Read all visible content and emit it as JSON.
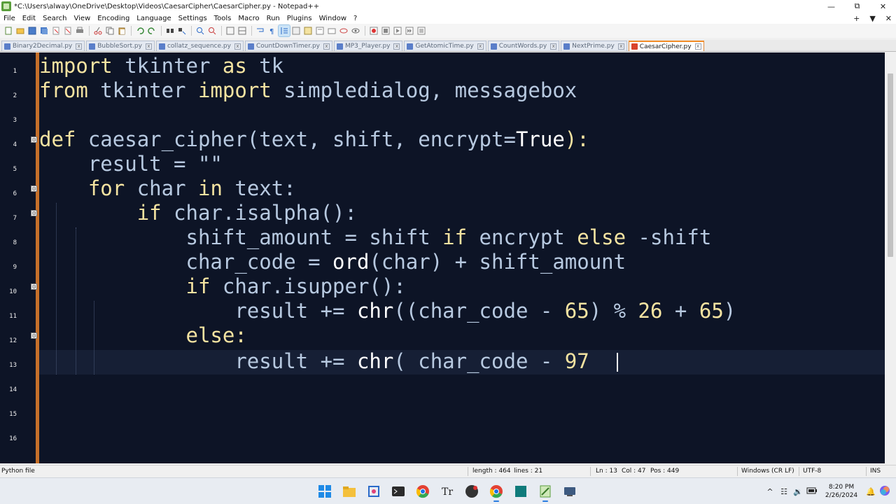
{
  "window": {
    "title": "*C:\\Users\\alway\\OneDrive\\Desktop\\Videos\\CaesarCipher\\CaesarCipher.py - Notepad++",
    "controls": {
      "minimize": "—",
      "restore": "⧉",
      "close": "✕"
    }
  },
  "menu": {
    "items": [
      "File",
      "Edit",
      "Search",
      "View",
      "Encoding",
      "Language",
      "Settings",
      "Tools",
      "Macro",
      "Run",
      "Plugins",
      "Window",
      "?"
    ],
    "right": {
      "add": "+",
      "dropdown": "▼",
      "close": "✕"
    }
  },
  "tabs": [
    {
      "label": "Binary2Decimal.py",
      "active": false
    },
    {
      "label": "BubbleSort.py",
      "active": false
    },
    {
      "label": "collatz_sequence.py",
      "active": false
    },
    {
      "label": "CountDownTimer.py",
      "active": false
    },
    {
      "label": "MP3_Player.py",
      "active": false
    },
    {
      "label": "GetAtomicTime.py",
      "active": false
    },
    {
      "label": "CountWords.py",
      "active": false
    },
    {
      "label": "NextPrime.py",
      "active": false
    },
    {
      "label": "CaesarCipher.py",
      "active": true
    }
  ],
  "tab_close_glyph": "x",
  "line_numbers": [
    "1",
    "2",
    "3",
    "4",
    "5",
    "6",
    "7",
    "8",
    "9",
    "10",
    "11",
    "12",
    "13",
    "14",
    "15",
    "16"
  ],
  "fold_markers": [
    "⊟",
    "⊟",
    "⊟",
    "⊟",
    "⊟"
  ],
  "code": {
    "l1": {
      "a": "import",
      "b": " tkinter ",
      "c": "as",
      "d": " tk"
    },
    "l2": {
      "a": "from",
      "b": " tkinter ",
      "c": "import",
      "d": " simpledialog, messagebox"
    },
    "l4": {
      "a": "def",
      "b": " caesar_cipher(text, shift, encrypt=",
      "c": "True",
      "d": "):"
    },
    "l5": {
      "a": "    result = \"\""
    },
    "l6": {
      "a": "    ",
      "b": "for",
      "c": " char ",
      "d": "in",
      "e": " text:"
    },
    "l7": {
      "a": "        ",
      "b": "if",
      "c": " char.isalpha():"
    },
    "l8": {
      "a": "            shift_amount = shift ",
      "b": "if",
      "c": " encrypt ",
      "d": "else",
      "e": " -shift"
    },
    "l9": {
      "a": "            char_code = ",
      "b": "ord",
      "c": "(char) + shift_amount"
    },
    "l10": {
      "a": "            ",
      "b": "if",
      "c": " char.isupper():"
    },
    "l11": {
      "a": "                result += ",
      "b": "chr",
      "c": "((char_code - ",
      "d": "65",
      "e": ") % ",
      "f": "26",
      "g": " + ",
      "h": "65",
      "i": ")"
    },
    "l12": {
      "a": "            ",
      "b": "else",
      "c": ":"
    },
    "l13": {
      "a": "                result += ",
      "b": "chr",
      "c": "( char_code - ",
      "d": "97",
      "e": " "
    }
  },
  "status": {
    "file_type": "Python file",
    "length": "length : 464",
    "lines": "lines : 21",
    "ln": "Ln : 13",
    "col": "Col : 47",
    "pos": "Pos : 449",
    "eol": "Windows (CR LF)",
    "encoding": "UTF-8",
    "mode": "INS"
  },
  "taskbar": {
    "icons": [
      "windows-start-icon",
      "file-explorer-icon",
      "snipping-tool-icon",
      "terminal-icon",
      "chrome-icon",
      "typora-icon",
      "github-desktop-icon",
      "chrome-profile-icon",
      "app-teal-icon",
      "notepadpp-icon",
      "vm-icon"
    ],
    "tray": {
      "chevron": "^",
      "speaker": "🔉",
      "network": "☷",
      "bell": "🔔"
    },
    "time": "8:20 PM",
    "date": "2/26/2024"
  }
}
